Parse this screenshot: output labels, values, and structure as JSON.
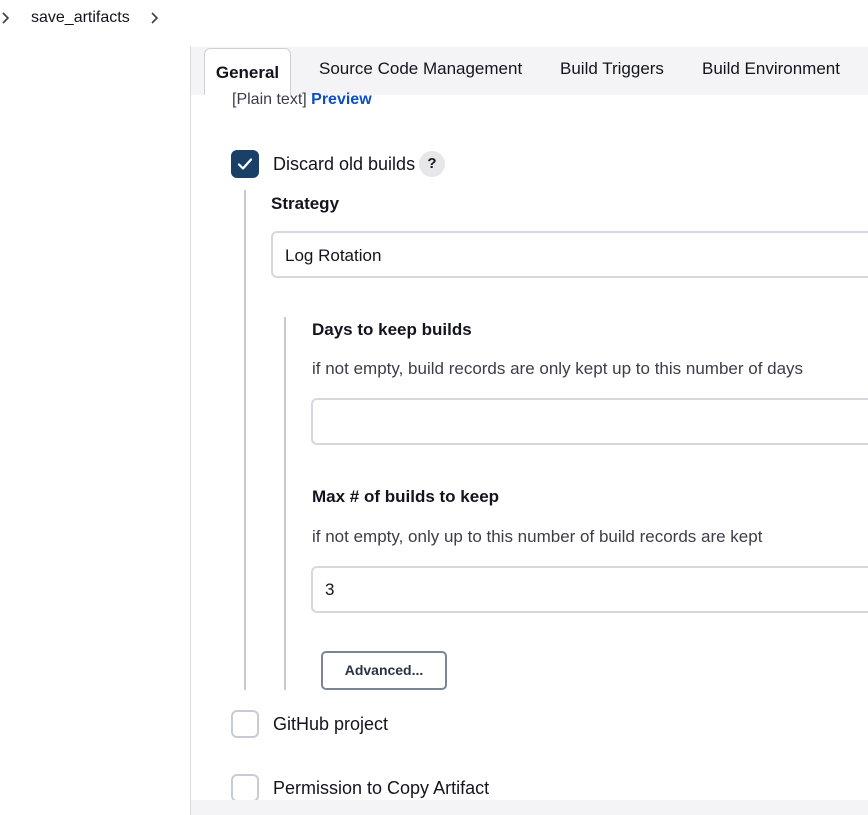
{
  "breadcrumb": {
    "item": "save_artifacts"
  },
  "tabs": [
    "General",
    "Source Code Management",
    "Build Triggers",
    "Build Environment"
  ],
  "description_format": {
    "plain_text": "[Plain text]",
    "preview_link": "Preview"
  },
  "discard_old_builds": {
    "label": "Discard old builds",
    "checked": true,
    "help": "?"
  },
  "strategy": {
    "label": "Strategy",
    "value": "Log Rotation"
  },
  "days_to_keep": {
    "label": "Days to keep builds",
    "description": "if not empty, build records are only kept up to this number of days",
    "value": ""
  },
  "max_builds": {
    "label": "Max # of builds to keep",
    "description": "if not empty, only up to this number of build records are kept",
    "value": "3"
  },
  "advanced_button": "Advanced...",
  "github_project": {
    "label": "GitHub project",
    "checked": false
  },
  "copy_artifact": {
    "label": "Permission to Copy Artifact",
    "checked": false
  }
}
